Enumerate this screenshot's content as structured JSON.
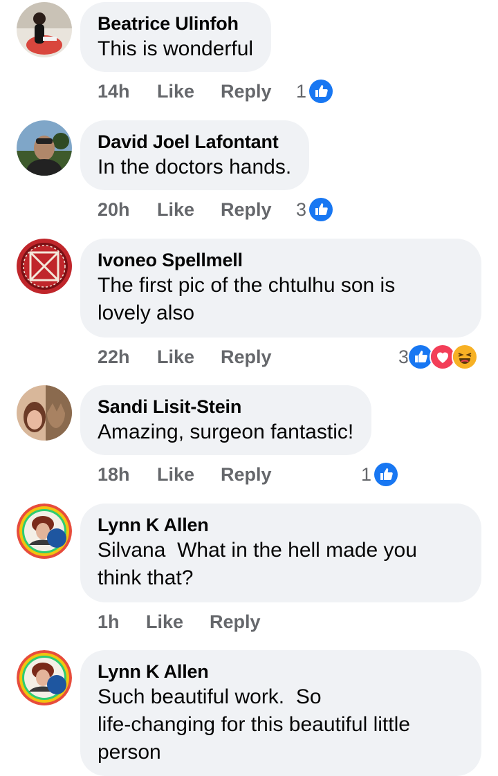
{
  "colors": {
    "bubble": "#f0f2f5",
    "meta": "#65676b",
    "like_blue": "#1877f2",
    "love_red": "#f33e58",
    "haha_yellow": "#f7b125"
  },
  "comments": [
    {
      "author": "Beatrice Ulinfoh",
      "text": "This is wonderful",
      "time": "14h",
      "like_label": "Like",
      "reply_label": "Reply",
      "reaction_count": "1",
      "reactions": [
        "like-icon"
      ]
    },
    {
      "author": "David Joel Lafontant",
      "text": "In the doctors hands.",
      "time": "20h",
      "like_label": "Like",
      "reply_label": "Reply",
      "reaction_count": "3",
      "reactions": [
        "like-icon"
      ]
    },
    {
      "author": "Ivoneo Spellmell",
      "text": "The first pic of the chtulhu son is\nlovely also",
      "time": "22h",
      "like_label": "Like",
      "reply_label": "Reply",
      "reaction_count": "3",
      "reactions": [
        "like-icon",
        "love-icon",
        "haha-icon"
      ]
    },
    {
      "author": "Sandi Lisit-Stein",
      "text": "Amazing, surgeon fantastic!",
      "time": "18h",
      "like_label": "Like",
      "reply_label": "Reply",
      "reaction_count": "1",
      "reactions": [
        "like-icon"
      ]
    },
    {
      "author": "Lynn K Allen",
      "text": "Silvana  What in the hell made you\nthink that?",
      "time": "1h",
      "like_label": "Like",
      "reply_label": "Reply"
    },
    {
      "author": "Lynn K Allen",
      "text": "Such beautiful work.  So\nlife-changing for this beautiful little\nperson"
    }
  ]
}
